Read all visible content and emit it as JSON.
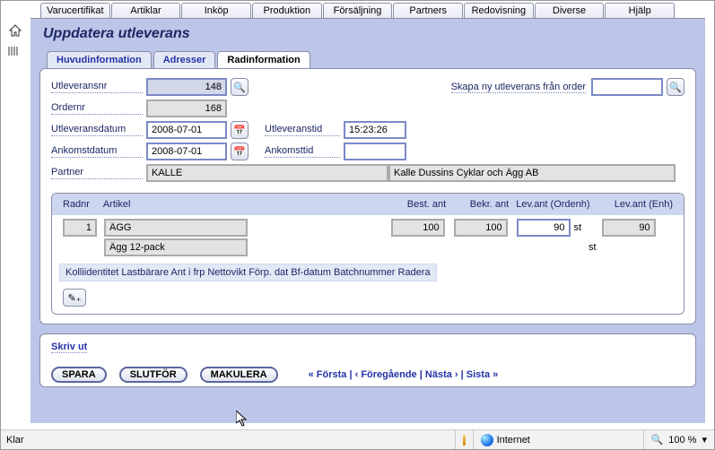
{
  "topTabs": [
    "Varucertifikat",
    "Artiklar",
    "Inköp",
    "Produktion",
    "Försäljning",
    "Partners",
    "Redovisning",
    "Diverse",
    "Hjälp"
  ],
  "pageTitle": "Uppdatera utleverans",
  "subTabs": {
    "huvud": "Huvudinformation",
    "adresser": "Adresser",
    "rad": "Radinformation"
  },
  "top": {
    "skapaLabel": "Skapa ny utleverans från order",
    "skapaValue": ""
  },
  "fields": {
    "utleveransnr": {
      "label": "Utleveransnr",
      "value": "148"
    },
    "ordernr": {
      "label": "Ordernr",
      "value": "168"
    },
    "utleveransdatum": {
      "label": "Utleveransdatum",
      "value": "2008-07-01"
    },
    "utleveranstid": {
      "label": "Utleveranstid",
      "value": "15:23:26"
    },
    "ankomstdatum": {
      "label": "Ankomstdatum",
      "value": "2008-07-01"
    },
    "ankomsttid": {
      "label": "Ankomsttid",
      "value": ""
    },
    "partner": {
      "label": "Partner",
      "code": "KALLE",
      "name": "Kalle Dussins Cyklar och Ägg AB"
    }
  },
  "table": {
    "headers": {
      "radnr": "Radnr",
      "artikel": "Artikel",
      "bestant": "Best. ant",
      "bekrant": "Bekr. ant",
      "levant_ordenh": "Lev.ant (Ordenh)",
      "levant_enh": "Lev.ant (Enh)"
    },
    "row": {
      "radnr": "1",
      "artikel": "ÄGG",
      "artikelDesc": "Ägg 12-pack",
      "bestant": "100",
      "bekrant": "100",
      "levant": "90",
      "enh1": "st",
      "levant_enh": "90",
      "enh2": "st"
    },
    "tags": "Kolliidentitet Lastbärare Ant i frp Nettovikt Förp. dat Bf-datum Batchnummer Radera"
  },
  "bottom": {
    "skrivut": "Skriv ut",
    "spara": "SPARA",
    "slutfor": "SLUTFÖR",
    "makulera": "MAKULERA",
    "nav": {
      "forsta": "« Första",
      "foregaende": "‹ Föregående",
      "nasta": "Nästa ›",
      "sista": "Sista »"
    }
  },
  "status": {
    "klar": "Klar",
    "internet": "Internet",
    "zoom": "100 %"
  }
}
